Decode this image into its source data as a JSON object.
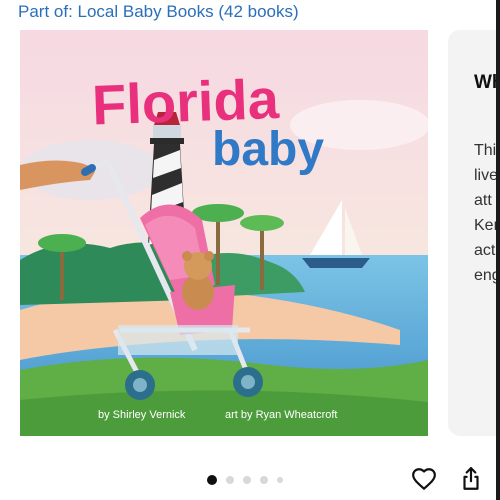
{
  "series": {
    "label": "Part of: Local Baby Books (42 books)"
  },
  "cover": {
    "title_line1": "Florida",
    "title_line2": "baby",
    "author": "by Shirley Vernick",
    "illustrator": "art by Ryan Wheatcroft"
  },
  "side_panel": {
    "heading": "Wh",
    "lines": [
      "Thi",
      "live",
      "att",
      "Ker",
      "act",
      "eng"
    ]
  },
  "carousel": {
    "image_count": 5,
    "active_index": 0
  },
  "actions": {
    "favorite_icon": "heart-icon",
    "share_icon": "share-icon"
  },
  "colors": {
    "link": "#2a6fb8",
    "title_pink": "#e8307c",
    "title_blue": "#2f79c6",
    "stroller_pink": "#ee6fa6"
  }
}
